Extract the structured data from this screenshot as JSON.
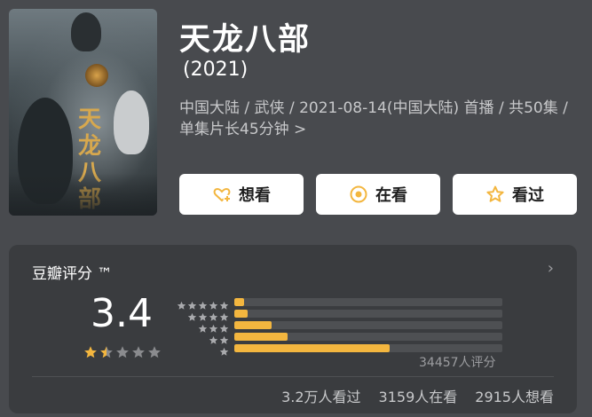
{
  "movie": {
    "title": "天龙八部",
    "year": "(2021)",
    "poster_title": "天龙八部",
    "meta_line": "中国大陆 / 武侠 / 2021-08-14(中国大陆) 首播 / 共50集 / 单集片长45分钟",
    "meta_chevron": ">"
  },
  "actions": {
    "want_label": "想看",
    "watching_label": "在看",
    "watched_label": "看过"
  },
  "rating": {
    "panel_title": "豆瓣评分 ™",
    "panel_chevron": "›",
    "score": "3.4",
    "score_stars": 1.5,
    "distribution": [
      {
        "stars": 5,
        "percent": 3.0
      },
      {
        "stars": 4,
        "percent": 5.0
      },
      {
        "stars": 3,
        "percent": 14.0
      },
      {
        "stars": 2,
        "percent": 20.0
      },
      {
        "stars": 1,
        "percent": 58.0
      }
    ],
    "votes": "34457人评分",
    "stats": {
      "watched": "3.2万人看过",
      "watching": "3159人在看",
      "want": "2915人想看"
    }
  },
  "colors": {
    "accent": "#f3b63f",
    "background": "#484a4e",
    "panel": "#3a3c3f",
    "button": "#ffffff"
  }
}
